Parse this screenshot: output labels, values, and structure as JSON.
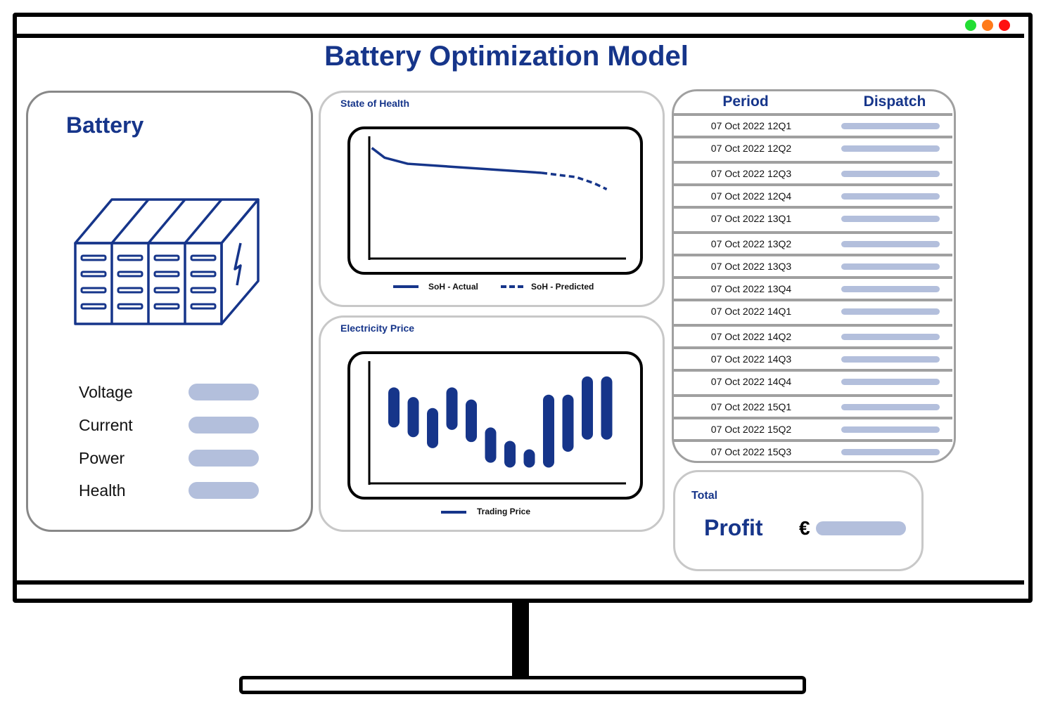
{
  "window": {
    "controls": [
      {
        "name": "maximize",
        "color": "#22dd33"
      },
      {
        "name": "minimize",
        "color": "#ff7a1a"
      },
      {
        "name": "close",
        "color": "#ff1111"
      }
    ]
  },
  "title": "Battery Optimization Model",
  "colors": {
    "accent": "#16358a",
    "placeholder": "#b3bfdc"
  },
  "battery": {
    "title": "Battery",
    "icon": "battery-rack-icon",
    "metrics": [
      {
        "label": "Voltage",
        "value": ""
      },
      {
        "label": "Current",
        "value": ""
      },
      {
        "label": "Power",
        "value": ""
      },
      {
        "label": "Health",
        "value": ""
      }
    ]
  },
  "soh": {
    "title": "State of Health",
    "legend": [
      "SoH - Actual",
      "SoH - Predicted"
    ]
  },
  "price": {
    "title": "Electricity Price",
    "legend": [
      "Trading Price"
    ]
  },
  "table": {
    "headers": [
      "Period",
      "Dispatch"
    ],
    "rows": [
      "07 Oct 2022 12Q1",
      "07 Oct 2022 12Q2",
      "07 Oct 2022 12Q3",
      "07 Oct 2022 12Q4",
      "07 Oct 2022 13Q1",
      "07 Oct 2022 13Q2",
      "07 Oct 2022 13Q3",
      "07 Oct 2022 13Q4",
      "07 Oct 2022 14Q1",
      "07 Oct 2022 14Q2",
      "07 Oct 2022 14Q3",
      "07 Oct 2022 14Q4",
      "07 Oct 2022 15Q1",
      "07 Oct 2022 15Q2",
      "07 Oct 2022 15Q3"
    ]
  },
  "profit": {
    "label_small": "Total",
    "label": "Profit",
    "currency": "€",
    "value": ""
  },
  "chart_data": [
    {
      "type": "line",
      "title": "State of Health",
      "grid": false,
      "legend_placement": "bottom",
      "series": [
        {
          "name": "SoH - Actual",
          "style": "solid",
          "x": [
            1,
            6,
            15,
            67.5
          ],
          "y": [
            91,
            83,
            78,
            70.5
          ]
        },
        {
          "name": "SoH - Predicted",
          "style": "dashed",
          "x": [
            67.5,
            81,
            88,
            93
          ],
          "y": [
            70.5,
            67,
            62,
            57
          ]
        }
      ],
      "xlim": [
        0,
        100
      ],
      "ylim": [
        0,
        100
      ]
    },
    {
      "type": "bar",
      "title": "Electricity Price",
      "grid": false,
      "legend_placement": "bottom",
      "series": [
        {
          "name": "Trading Price",
          "low": [
            46,
            38,
            29,
            44,
            34,
            17,
            13,
            13,
            13,
            26,
            36,
            36
          ],
          "high": [
            79,
            71,
            62,
            79,
            69,
            46,
            35,
            28,
            73,
            73,
            88,
            88
          ]
        }
      ],
      "ylim": [
        0,
        100
      ]
    }
  ]
}
